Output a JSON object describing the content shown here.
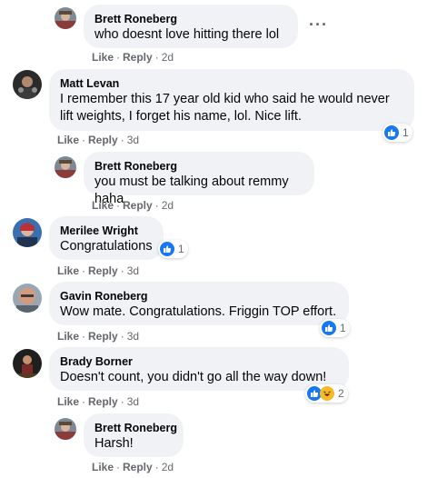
{
  "comments": [
    {
      "author": "Brett Roneberg",
      "text": "who doesnt love hitting there lol",
      "like": "Like",
      "reply": "Reply",
      "time": "2d",
      "more_icon": "ellipsis-icon"
    },
    {
      "author": "Matt Levan",
      "text": "I remember this 17 year old kid who said he would never lift weights, I forget his name, lol. Nice lift.",
      "like": "Like",
      "reply": "Reply",
      "time": "3d",
      "reaction_count": "1"
    },
    {
      "author": "Brett Roneberg",
      "text": "you must be talking about remmy haha",
      "like": "Like",
      "reply": "Reply",
      "time": "2d"
    },
    {
      "author": "Merilee Wright",
      "text": "Congratulations",
      "like": "Like",
      "reply": "Reply",
      "time": "3d",
      "reaction_count": "1"
    },
    {
      "author": "Gavin Roneberg",
      "text": "Wow mate. Congratulations. Friggin TOP effort.",
      "like": "Like",
      "reply": "Reply",
      "time": "3d",
      "reaction_count": "1"
    },
    {
      "author": "Brady Borner",
      "text": "Doesn't count, you didn't go all the way down!",
      "like": "Like",
      "reply": "Reply",
      "time": "3d",
      "reaction_count": "2"
    },
    {
      "author": "Brett Roneberg",
      "text": "Harsh!",
      "like": "Like",
      "reply": "Reply",
      "time": "2d"
    }
  ],
  "separator": "·",
  "colors": {
    "bubble": "#f0f2f5",
    "meta_text": "#65676b",
    "like_blue": "#1877f2",
    "haha_yellow": "#f7b928"
  }
}
